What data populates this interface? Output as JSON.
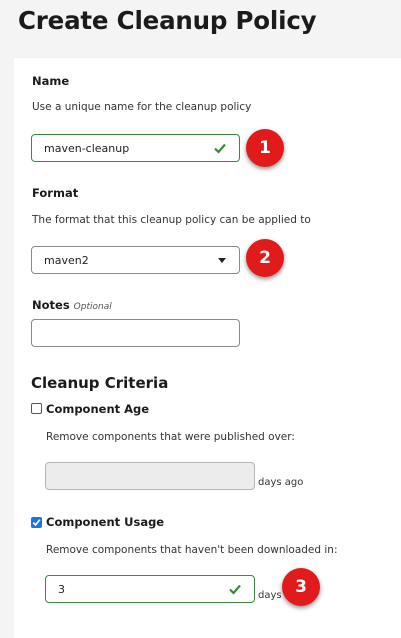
{
  "page": {
    "title": "Create Cleanup Policy"
  },
  "name_field": {
    "label": "Name",
    "help": "Use a unique name for the cleanup policy",
    "value": "maven-cleanup",
    "badge": "1"
  },
  "format_field": {
    "label": "Format",
    "help": "The format that this cleanup policy can be applied to",
    "value": "maven2",
    "badge": "2"
  },
  "notes_field": {
    "label": "Notes",
    "optional": "Optional",
    "value": ""
  },
  "criteria": {
    "title": "Cleanup Criteria",
    "component_age": {
      "label": "Component Age",
      "checked": false,
      "help": "Remove components that were published over:",
      "value": "",
      "units": "days ago"
    },
    "component_usage": {
      "label": "Component Usage",
      "checked": true,
      "help": "Remove components that haven't been downloaded in:",
      "value": "3",
      "units": "days",
      "badge": "3"
    }
  },
  "colors": {
    "valid": "#3c8a3c",
    "badge": "#e11b1b",
    "checkbox_checked": "#1a73e8"
  }
}
